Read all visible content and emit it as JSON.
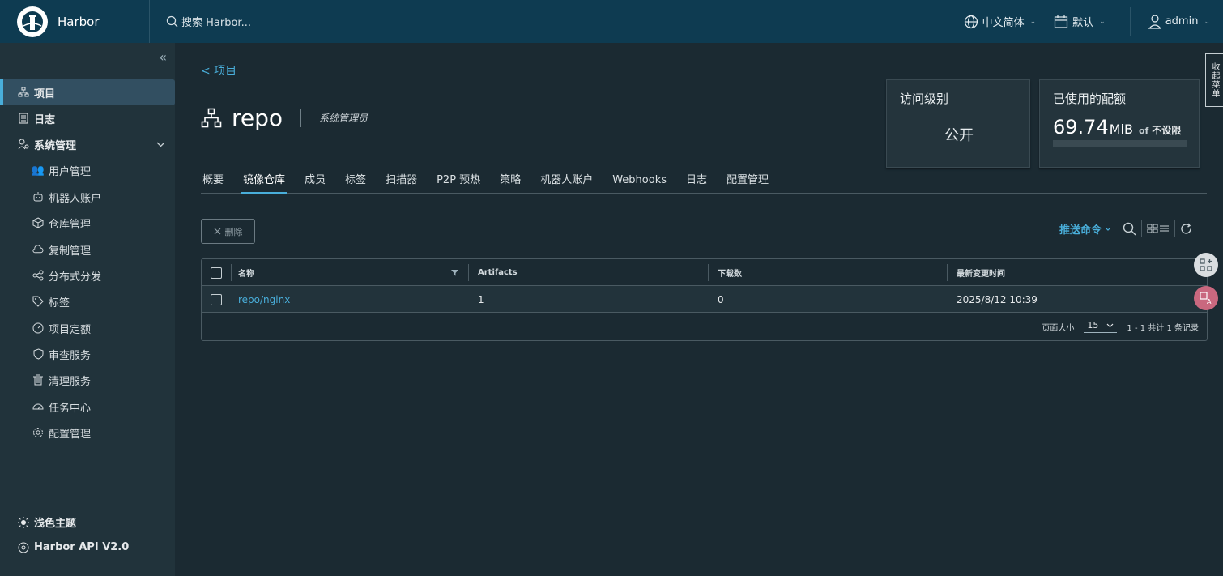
{
  "header": {
    "app_title": "Harbor",
    "search_placeholder": "搜索 Harbor...",
    "language": "中文简体",
    "datetime_format": "默认",
    "user": "admin"
  },
  "sidebar": {
    "items": [
      {
        "label": "项目",
        "icon": "project-icon",
        "active": true
      },
      {
        "label": "日志",
        "icon": "log-icon"
      },
      {
        "label": "系统管理",
        "icon": "admin-icon",
        "expanded": true
      }
    ],
    "sub_items": [
      {
        "label": "用户管理",
        "icon": "users-icon"
      },
      {
        "label": "机器人账户",
        "icon": "robot-icon"
      },
      {
        "label": "仓库管理",
        "icon": "box-icon"
      },
      {
        "label": "复制管理",
        "icon": "cloud-icon"
      },
      {
        "label": "分布式分发",
        "icon": "share-icon"
      },
      {
        "label": "标签",
        "icon": "tag-icon"
      },
      {
        "label": "项目定额",
        "icon": "gauge-icon"
      },
      {
        "label": "审查服务",
        "icon": "shield-icon"
      },
      {
        "label": "清理服务",
        "icon": "trash-icon"
      },
      {
        "label": "任务中心",
        "icon": "dashboard-icon"
      },
      {
        "label": "配置管理",
        "icon": "gear-icon"
      }
    ],
    "theme_toggle": "浅色主题",
    "api_link": "Harbor API V2.0"
  },
  "breadcrumb": {
    "back_label": "<  项目"
  },
  "project": {
    "name": "repo",
    "role": "系统管理员"
  },
  "access_card": {
    "title": "访问级别",
    "value": "公开"
  },
  "quota_card": {
    "title": "已使用的配额",
    "used": "69.74",
    "unit": "MiB",
    "of": "of",
    "limit": "不设限",
    "used_fraction": 0
  },
  "tabs": [
    "概要",
    "镜像仓库",
    "成员",
    "标签",
    "扫描器",
    "P2P 预热",
    "策略",
    "机器人账户",
    "Webhooks",
    "日志",
    "配置管理"
  ],
  "active_tab": "镜像仓库",
  "toolbar": {
    "delete_label": "删除",
    "push_command": "推送命令"
  },
  "table": {
    "columns": [
      "名称",
      "Artifacts",
      "下载数",
      "最新变更时间"
    ],
    "rows": [
      {
        "name": "repo/nginx",
        "artifacts": "1",
        "downloads": "0",
        "updated": "2025/8/12 10:39"
      }
    ],
    "page_size_label": "页面大小",
    "page_size": "15",
    "summary": "1 - 1 共计 1 条记录"
  },
  "right_tab": "收起菜单",
  "colors": {
    "accent": "#49aeda",
    "header_bg": "#0e3b51",
    "sidebar_bg": "#21333b",
    "main_bg": "#1b2a32"
  }
}
